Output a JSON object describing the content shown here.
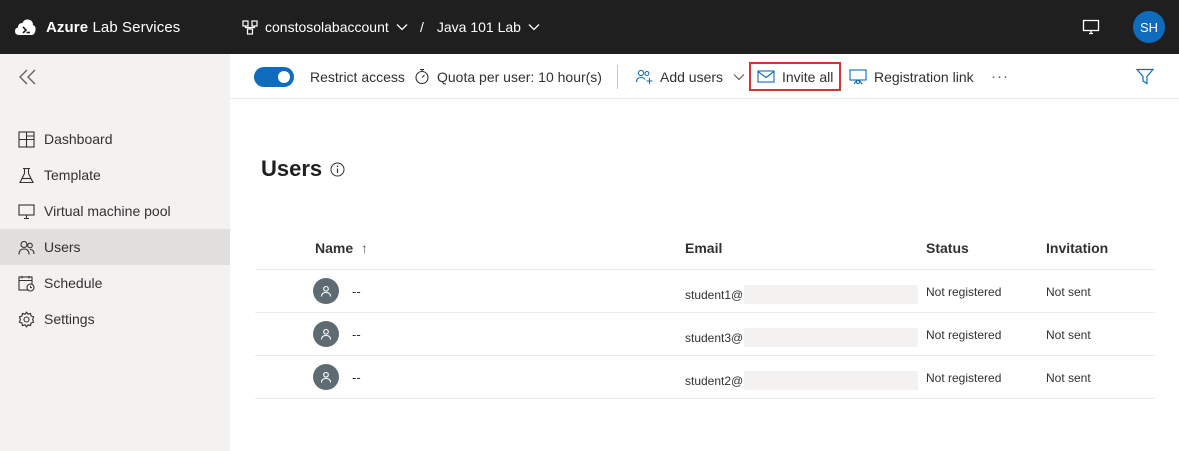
{
  "app": {
    "brand_strong": "Azure",
    "brand_rest": " Lab Services",
    "account": "constosolabaccount",
    "separator": "/",
    "lab": "Java 101 Lab",
    "user_initials": "SH"
  },
  "sidebar": {
    "items": [
      {
        "label": "Dashboard",
        "icon": "dashboard-icon"
      },
      {
        "label": "Template",
        "icon": "beaker-icon"
      },
      {
        "label": "Virtual machine pool",
        "icon": "monitor-icon"
      },
      {
        "label": "Users",
        "icon": "users-icon",
        "active": true
      },
      {
        "label": "Schedule",
        "icon": "calendar-icon"
      },
      {
        "label": "Settings",
        "icon": "gear-icon"
      }
    ]
  },
  "toolbar": {
    "restrict_access": "Restrict access",
    "restrict_access_on": true,
    "quota": "Quota per user: 10 hour(s)",
    "add_users": "Add users",
    "invite_all": "Invite all",
    "registration_link": "Registration link",
    "more": "···"
  },
  "main": {
    "title": "Users"
  },
  "table": {
    "columns": {
      "name": "Name",
      "name_sort": "↑",
      "email": "Email",
      "status": "Status",
      "invitation": "Invitation"
    },
    "rows": [
      {
        "name": "--",
        "email_prefix": "student1@",
        "status": "Not registered",
        "invitation": "Not sent"
      },
      {
        "name": "--",
        "email_prefix": "student3@",
        "status": "Not registered",
        "invitation": "Not sent"
      },
      {
        "name": "--",
        "email_prefix": "student2@",
        "status": "Not registered",
        "invitation": "Not sent"
      }
    ]
  },
  "colors": {
    "topbar": "#1f1f1f",
    "accent": "#0f6cbd",
    "highlight_border": "#d13438",
    "sidebar_bg": "#f3f2f1",
    "active_item": "#e1dfdd"
  }
}
